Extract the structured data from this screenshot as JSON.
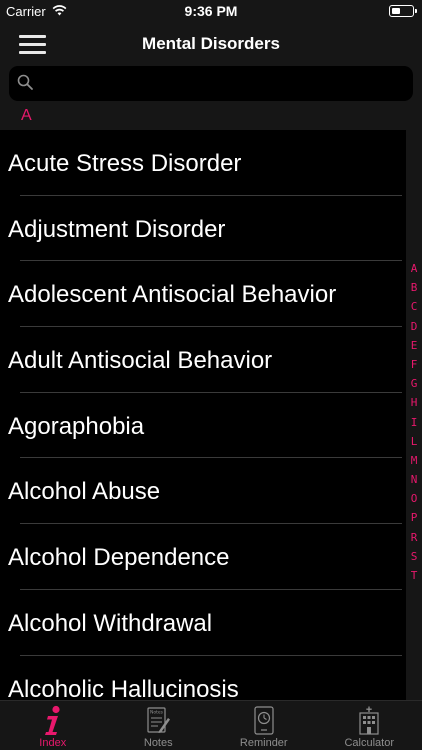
{
  "status": {
    "carrier": "Carrier",
    "time": "9:36 PM"
  },
  "header": {
    "title": "Mental Disorders"
  },
  "search": {
    "placeholder": ""
  },
  "section": {
    "letter": "A"
  },
  "items": [
    "Acute Stress Disorder",
    "Adjustment Disorder",
    "Adolescent Antisocial Behavior",
    "Adult Antisocial Behavior",
    "Agoraphobia",
    "Alcohol Abuse",
    "Alcohol Dependence",
    "Alcohol Withdrawal",
    "Alcoholic Hallucinosis"
  ],
  "index_letters": [
    "A",
    "B",
    "C",
    "D",
    "E",
    "F",
    "G",
    "H",
    "I",
    "L",
    "M",
    "N",
    "O",
    "P",
    "R",
    "S",
    "T"
  ],
  "tabs": [
    {
      "label": "Index",
      "icon": "info-icon",
      "active": true
    },
    {
      "label": "Notes",
      "icon": "notes-icon",
      "active": false
    },
    {
      "label": "Reminder",
      "icon": "reminder-clock-icon",
      "active": false
    },
    {
      "label": "Calculator",
      "icon": "hospital-building-icon",
      "active": false
    }
  ],
  "colors": {
    "accent": "#e8186c",
    "background": "#161616",
    "list_background": "#000000",
    "inactive": "#8e8e8e"
  }
}
